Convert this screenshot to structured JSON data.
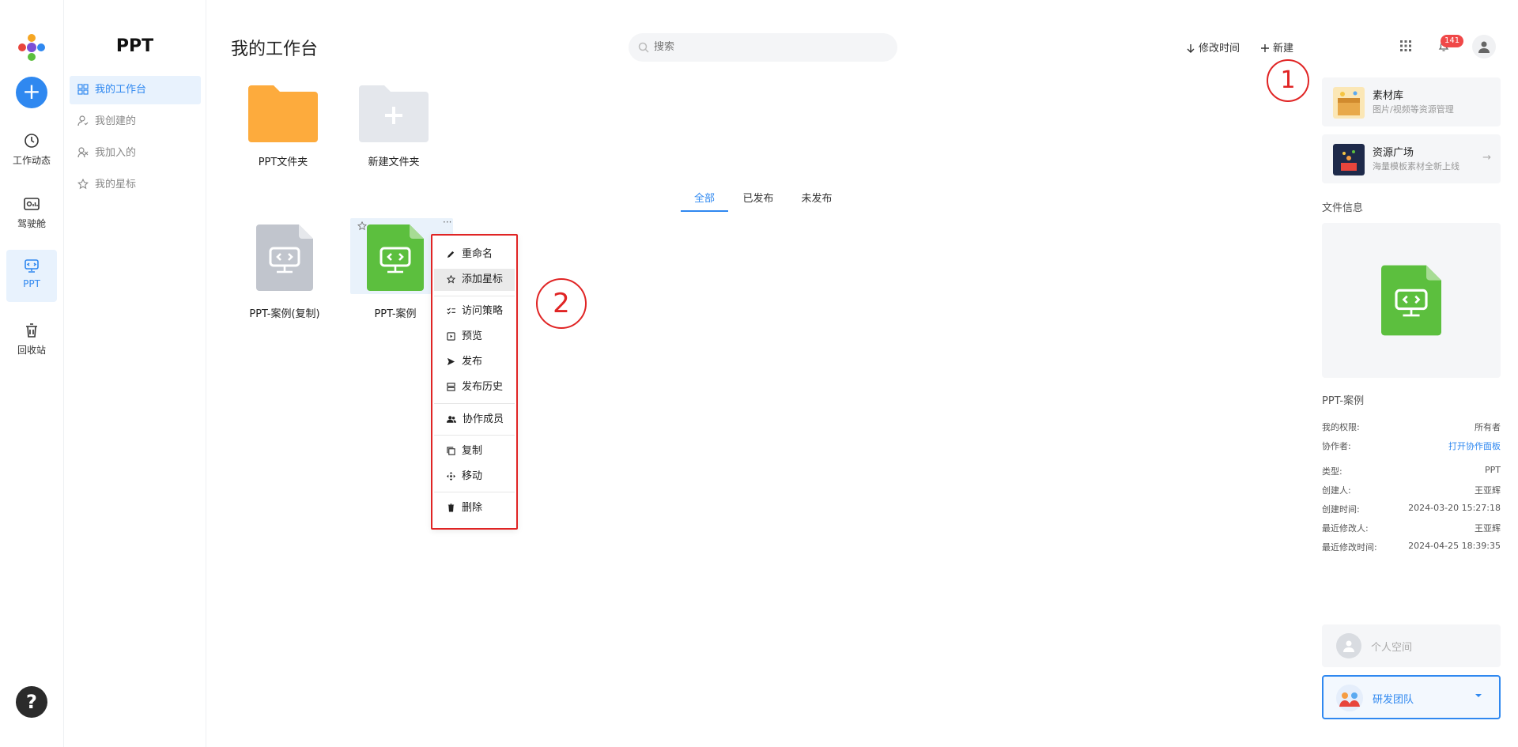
{
  "rail": {
    "items": [
      {
        "label": "工作动态"
      },
      {
        "label": "驾驶舱"
      },
      {
        "label": "PPT"
      },
      {
        "label": "回收站"
      }
    ],
    "help": "?"
  },
  "subnav": {
    "title": "PPT",
    "items": [
      {
        "label": "我的工作台"
      },
      {
        "label": "我创建的"
      },
      {
        "label": "我加入的"
      },
      {
        "label": "我的星标"
      }
    ]
  },
  "header": {
    "title": "我的工作台",
    "search_placeholder": "搜索",
    "sort_label": "修改时间",
    "new_label": "新建",
    "notification_count": "141"
  },
  "folders": [
    {
      "label": "PPT文件夹"
    },
    {
      "label": "新建文件夹"
    }
  ],
  "tabs": [
    {
      "label": "全部"
    },
    {
      "label": "已发布"
    },
    {
      "label": "未发布"
    }
  ],
  "files": [
    {
      "name": "PPT-案例(复制)"
    },
    {
      "name": "PPT-案例"
    }
  ],
  "context_menu": {
    "items": [
      {
        "label": "重命名"
      },
      {
        "label": "添加星标"
      },
      {
        "label": "访问策略"
      },
      {
        "label": "预览"
      },
      {
        "label": "发布"
      },
      {
        "label": "发布历史"
      },
      {
        "label": "协作成员"
      },
      {
        "label": "复制"
      },
      {
        "label": "移动"
      },
      {
        "label": "删除"
      }
    ]
  },
  "annotations": [
    "1",
    "2"
  ],
  "right": {
    "cards": [
      {
        "title": "素材库",
        "subtitle": "图片/视频等资源管理"
      },
      {
        "title": "资源广场",
        "subtitle": "海量模板素材全新上线",
        "arrow": "→"
      }
    ],
    "file_info_label": "文件信息",
    "file_name": "PPT-案例",
    "info": [
      {
        "k": "我的权限:",
        "v": "所有者"
      },
      {
        "k": "协作者:",
        "v": "打开协作面板"
      },
      {
        "k": "类型:",
        "v": "PPT"
      },
      {
        "k": "创建人:",
        "v": "王亚辉"
      },
      {
        "k": "创建时间:",
        "v": "2024-03-20 15:27:18"
      },
      {
        "k": "最近修改人:",
        "v": "王亚辉"
      },
      {
        "k": "最近修改时间:",
        "v": "2024-04-25 18:39:35"
      }
    ],
    "personal_space": "个人空间",
    "team": "研发团队"
  },
  "colors": {
    "accent": "#2f88f0",
    "folder": "#fdab3d",
    "ppt_green": "#5cbf3e",
    "ppt_gray": "#c1c5cd",
    "annotation": "#e02424"
  }
}
